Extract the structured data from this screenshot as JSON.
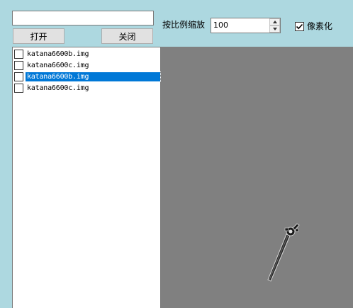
{
  "toolbar": {
    "path_value": "",
    "open_label": "打开",
    "close_label": "关闭",
    "scale_label": "按比例缩放",
    "scale_value": "100",
    "pixelate_label": "像素化",
    "pixelate_checked": true
  },
  "file_list": {
    "items": [
      {
        "label": "katana6600b.img",
        "checked": false,
        "selected": false
      },
      {
        "label": "katana6600c.img",
        "checked": false,
        "selected": false
      },
      {
        "label": "katana6600b.img",
        "checked": false,
        "selected": true
      },
      {
        "label": "katana6600c.img",
        "checked": false,
        "selected": false
      }
    ]
  },
  "preview": {
    "background": "#808080",
    "sprite": "katana-sprite"
  },
  "colors": {
    "window_bg": "#add8e0",
    "selection": "#0078d7"
  }
}
